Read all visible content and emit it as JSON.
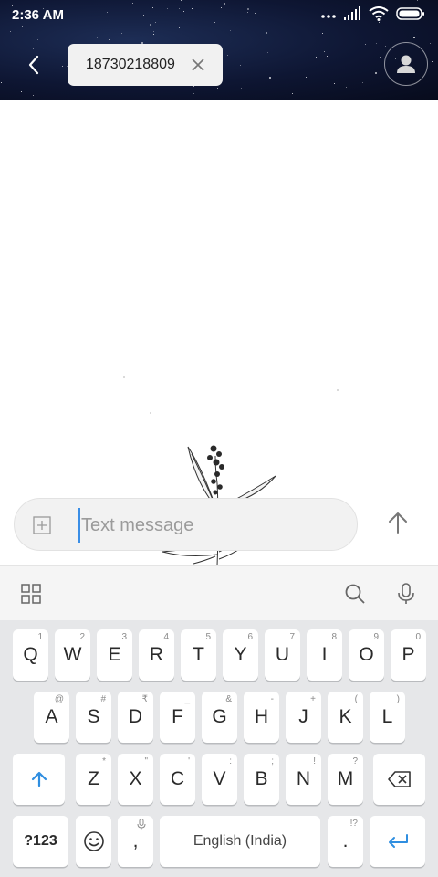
{
  "status_bar": {
    "time": "2:36 AM"
  },
  "header": {
    "recipient": "18730218809",
    "icons": [
      "back-arrow-icon",
      "close-icon",
      "contact-icon"
    ]
  },
  "compose": {
    "placeholder": "Text message",
    "value": "",
    "icons": [
      "attach-plus-icon",
      "send-arrow-icon"
    ]
  },
  "keyboard_toolbar": {
    "icons": [
      "apps-grid-icon",
      "search-icon",
      "mic-icon"
    ]
  },
  "keyboard": {
    "row1": [
      {
        "key": "Q",
        "hint": "1"
      },
      {
        "key": "W",
        "hint": "2"
      },
      {
        "key": "E",
        "hint": "3"
      },
      {
        "key": "R",
        "hint": "4"
      },
      {
        "key": "T",
        "hint": "5"
      },
      {
        "key": "Y",
        "hint": "6"
      },
      {
        "key": "U",
        "hint": "7"
      },
      {
        "key": "I",
        "hint": "8"
      },
      {
        "key": "O",
        "hint": "9"
      },
      {
        "key": "P",
        "hint": "0"
      }
    ],
    "row2": [
      {
        "key": "A",
        "hint": "@"
      },
      {
        "key": "S",
        "hint": "#"
      },
      {
        "key": "D",
        "hint": "₹"
      },
      {
        "key": "F",
        "hint": "_"
      },
      {
        "key": "G",
        "hint": "&"
      },
      {
        "key": "H",
        "hint": "-"
      },
      {
        "key": "J",
        "hint": "+"
      },
      {
        "key": "K",
        "hint": "("
      },
      {
        "key": "L",
        "hint": ")"
      }
    ],
    "row3": [
      {
        "key": "Z",
        "hint": "*"
      },
      {
        "key": "X",
        "hint": "\""
      },
      {
        "key": "C",
        "hint": "'"
      },
      {
        "key": "V",
        "hint": ":"
      },
      {
        "key": "B",
        "hint": ";"
      },
      {
        "key": "N",
        "hint": "!"
      },
      {
        "key": "M",
        "hint": "?"
      }
    ],
    "symbols_label": "?123",
    "comma_label": ",",
    "space_label": "English (India)",
    "period_label": ".",
    "period_hint": "!?",
    "accent_color": "#2f8ee0"
  }
}
